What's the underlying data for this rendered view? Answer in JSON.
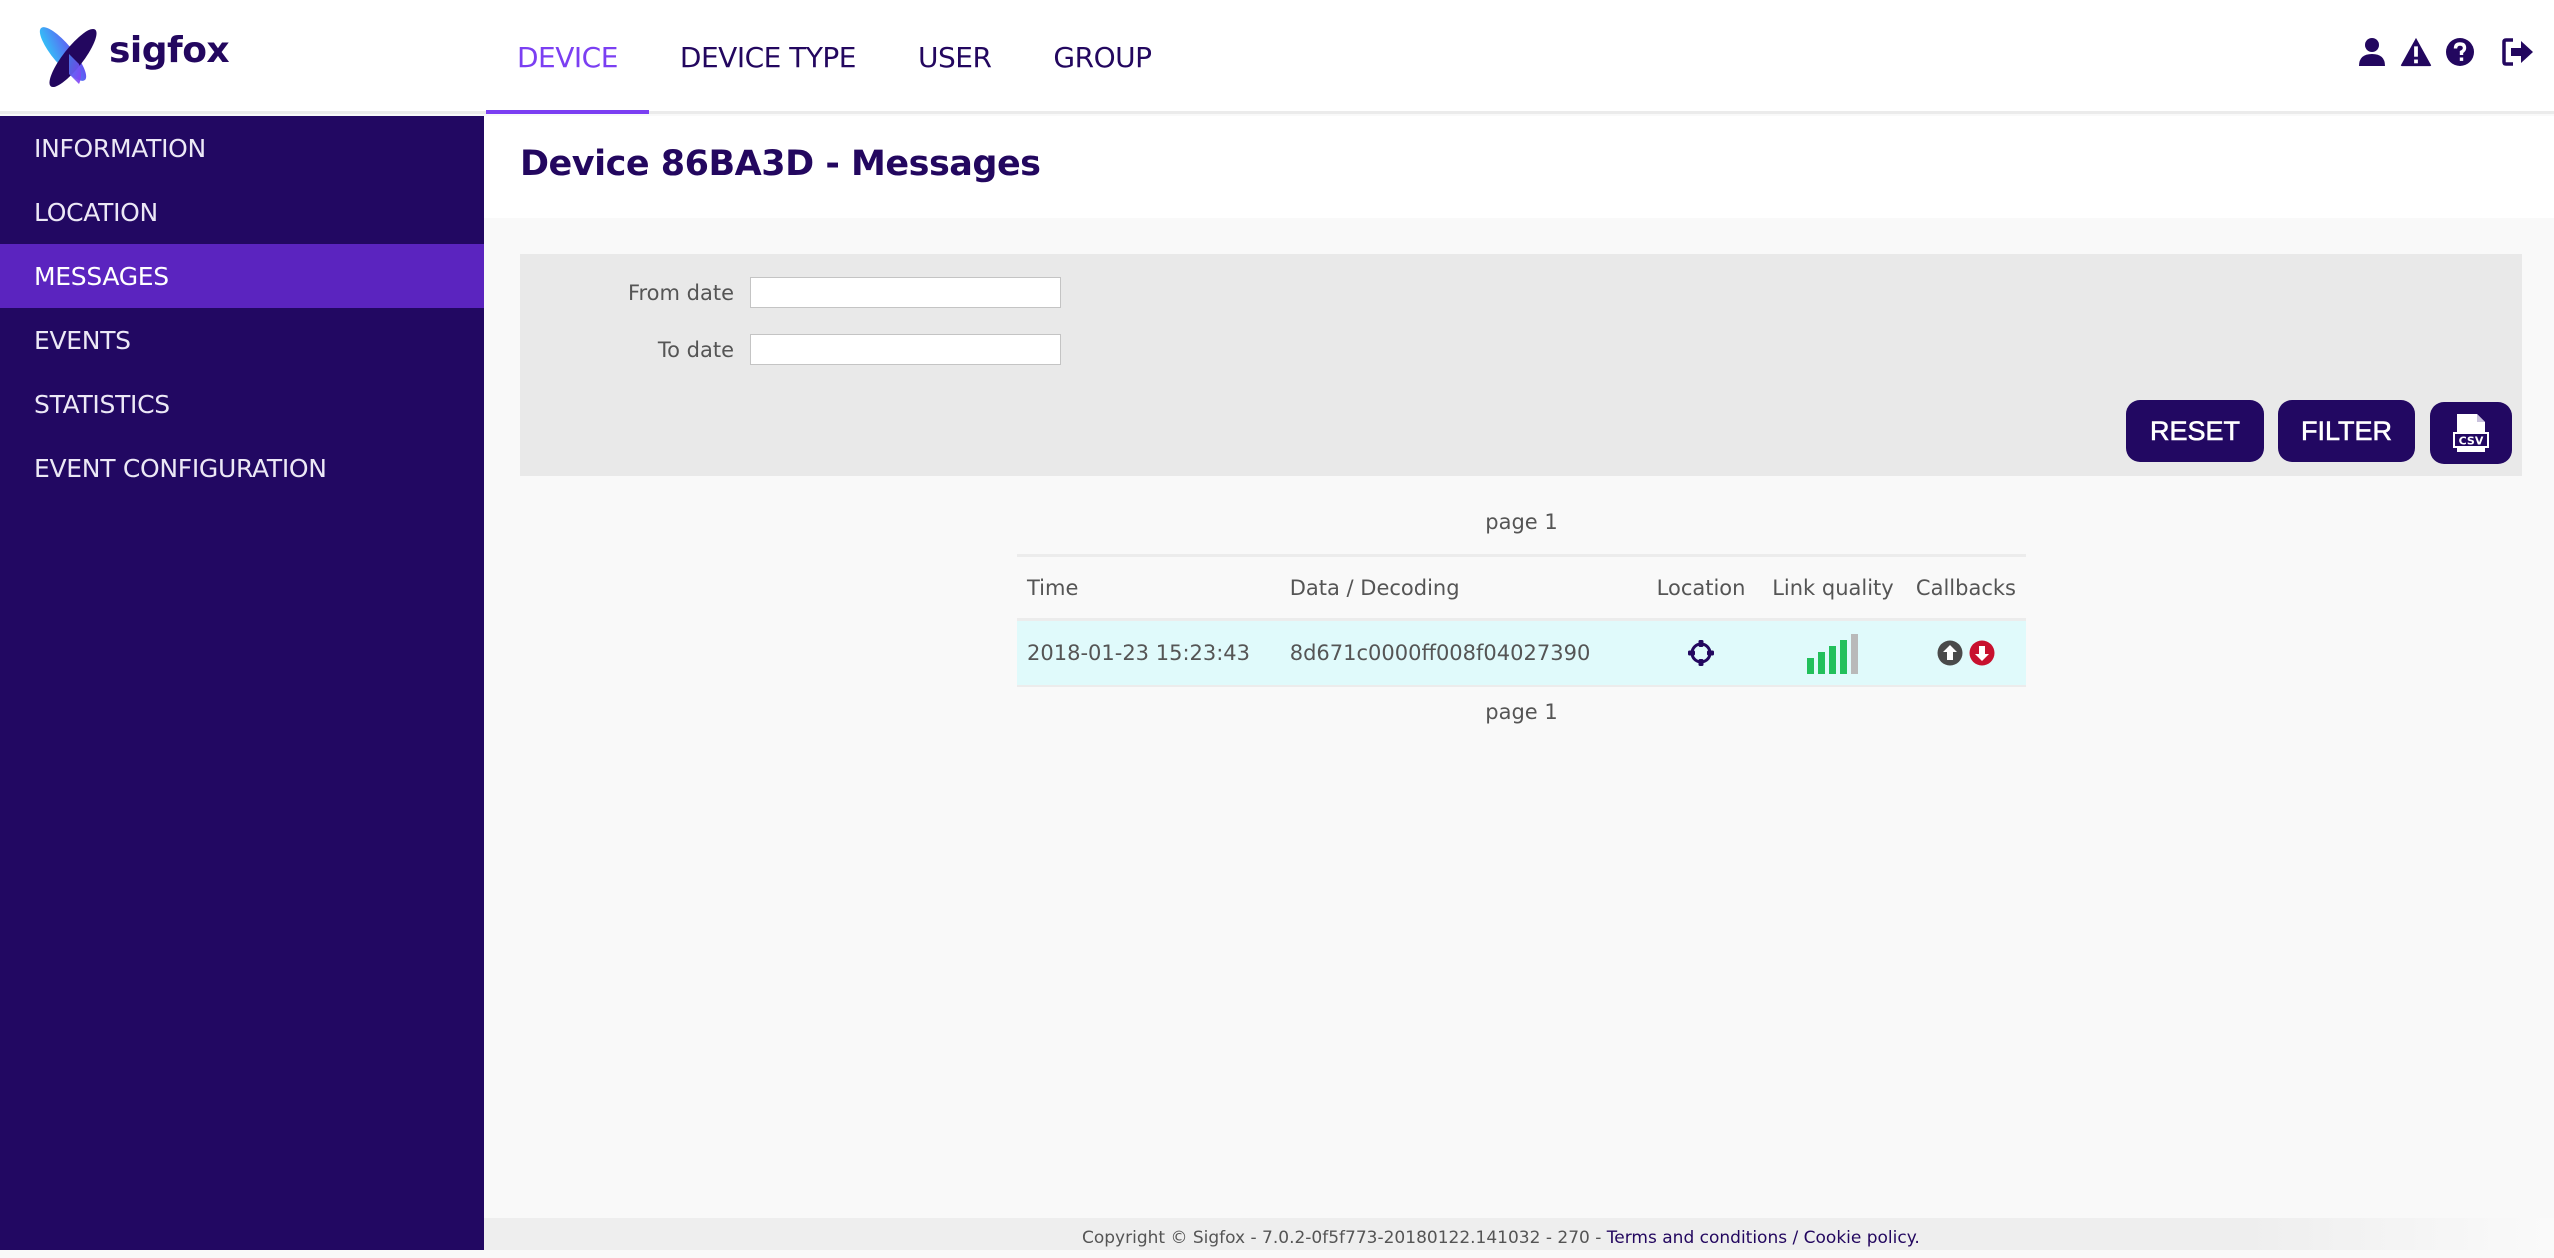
{
  "brand": {
    "name": "sigfox"
  },
  "colors": {
    "primary": "#220862",
    "accent": "#7b3ff2",
    "sidebar_active": "#5b24bf",
    "row_highlight": "#e0fafb",
    "signal_on": "#22c05b",
    "signal_off": "#b9b9b9",
    "callback_up": "#4a4a4a",
    "callback_down": "#c8102e"
  },
  "nav": {
    "tabs": [
      {
        "label": "DEVICE",
        "active": true
      },
      {
        "label": "DEVICE TYPE",
        "active": false
      },
      {
        "label": "USER",
        "active": false
      },
      {
        "label": "GROUP",
        "active": false
      }
    ],
    "icons": [
      "user-icon",
      "warning-icon",
      "help-icon",
      "sign-out-icon"
    ]
  },
  "sidebar": {
    "items": [
      {
        "label": "INFORMATION",
        "active": false
      },
      {
        "label": "LOCATION",
        "active": false
      },
      {
        "label": "MESSAGES",
        "active": true
      },
      {
        "label": "EVENTS",
        "active": false
      },
      {
        "label": "STATISTICS",
        "active": false
      },
      {
        "label": "EVENT CONFIGURATION",
        "active": false
      }
    ]
  },
  "page": {
    "title": "Device 86BA3D - Messages"
  },
  "filter": {
    "from_label": "From date",
    "from_value": "",
    "to_label": "To date",
    "to_value": "",
    "reset_label": "RESET",
    "filter_label": "FILTER",
    "csv_label": "CSV"
  },
  "pager": {
    "top": "page 1",
    "bottom": "page 1"
  },
  "table": {
    "columns": [
      "Time",
      "Data / Decoding",
      "Location",
      "Link quality",
      "Callbacks"
    ],
    "rows": [
      {
        "time": "2018-01-23 15:23:43",
        "data": "8d671c0000ff008f04027390",
        "location_icon": "crosshair-icon",
        "link_quality": {
          "bars": 4,
          "max": 5
        },
        "callbacks": [
          "callback-up-icon",
          "callback-down-icon"
        ]
      }
    ]
  },
  "footer": {
    "text": "Copyright © Sigfox - 7.0.2-0f5f773-20180122.141032 - 270 - ",
    "terms": "Terms and conditions",
    "separator": " / ",
    "cookie": "Cookie policy."
  }
}
